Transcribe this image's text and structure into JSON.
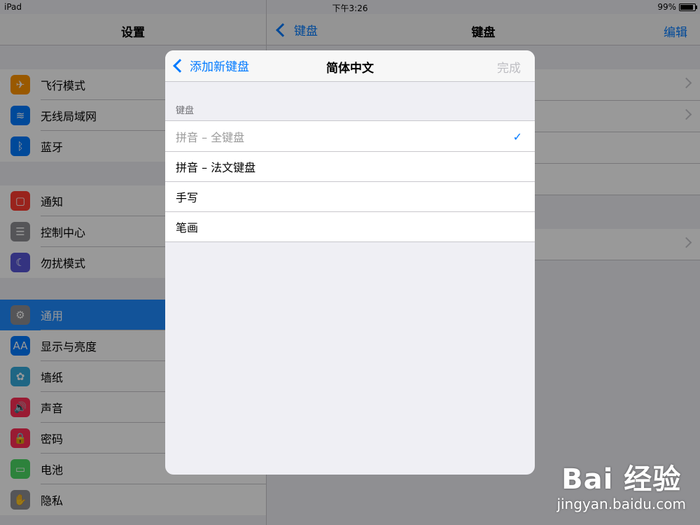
{
  "status": {
    "device": "iPad",
    "time": "下午3:26",
    "battery": "99%",
    "battery_level": 0.99
  },
  "left_nav": {
    "title": "设置"
  },
  "settings_groups": [
    [
      {
        "label": "飞行模式",
        "icon": "airplane-icon",
        "color": "#ff9500",
        "glyph": "✈"
      },
      {
        "label": "无线局域网",
        "icon": "wifi-icon",
        "color": "#007aff",
        "glyph": "≋"
      },
      {
        "label": "蓝牙",
        "icon": "bluetooth-icon",
        "color": "#007aff",
        "glyph": "ᛒ"
      }
    ],
    [
      {
        "label": "通知",
        "icon": "notifications-icon",
        "color": "#ff3b30",
        "glyph": "▢"
      },
      {
        "label": "控制中心",
        "icon": "control-center-icon",
        "color": "#8e8e93",
        "glyph": "☰"
      },
      {
        "label": "勿扰模式",
        "icon": "moon-icon",
        "color": "#5856d6",
        "glyph": "☾"
      }
    ],
    [
      {
        "label": "通用",
        "icon": "gear-icon",
        "color": "#8e8e93",
        "glyph": "⚙",
        "selected": true
      },
      {
        "label": "显示与亮度",
        "icon": "display-brightness-icon",
        "color": "#007aff",
        "glyph": "AA"
      },
      {
        "label": "墙纸",
        "icon": "wallpaper-icon",
        "color": "#34aadc",
        "glyph": "✿"
      },
      {
        "label": "声音",
        "icon": "sound-icon",
        "color": "#ff2d55",
        "glyph": "🔊"
      },
      {
        "label": "密码",
        "icon": "passcode-icon",
        "color": "#ff2d55",
        "glyph": "🔒"
      },
      {
        "label": "电池",
        "icon": "battery-icon",
        "color": "#4cd964",
        "glyph": "▭"
      },
      {
        "label": "隐私",
        "icon": "privacy-hand-icon",
        "color": "#8e8e93",
        "glyph": "✋"
      }
    ]
  ],
  "right_nav": {
    "back": "键盘",
    "title": "键盘",
    "edit": "编辑"
  },
  "modal": {
    "back": "添加新键盘",
    "title": "简体中文",
    "done": "完成",
    "section": "键盘",
    "options": [
      {
        "label": "拼音 – 全键盘",
        "checked": true
      },
      {
        "label": "拼音 – 法文键盘",
        "checked": false
      },
      {
        "label": "手写",
        "checked": false
      },
      {
        "label": "笔画",
        "checked": false
      }
    ]
  },
  "watermark": {
    "main": "Bai 经验",
    "sub": "jingyan.baidu.com"
  }
}
